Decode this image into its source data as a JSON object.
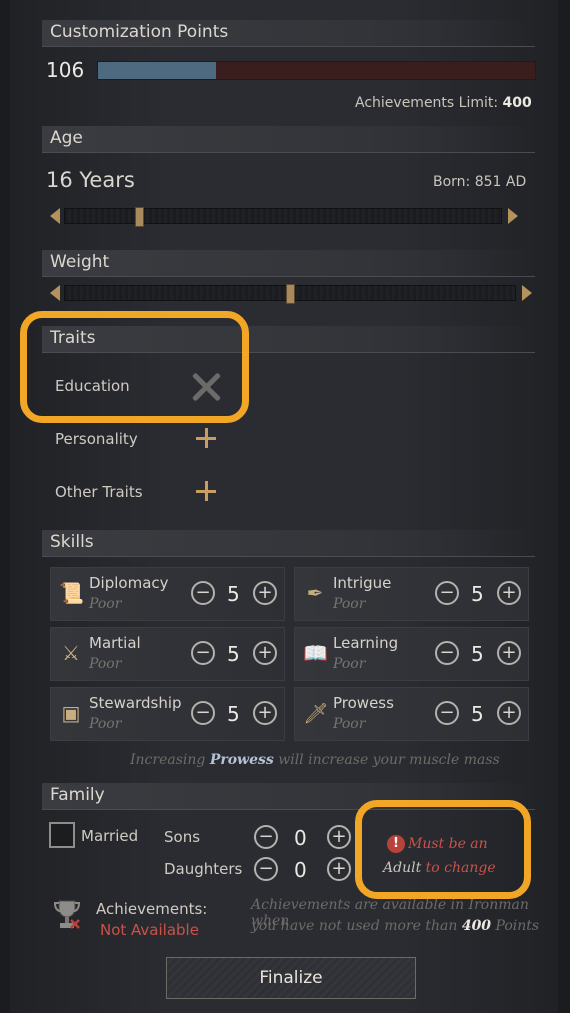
{
  "customization": {
    "header": "Customization Points",
    "points": "106",
    "progress_fraction": 0.27,
    "limit_label": "Achievements Limit:",
    "limit_value": "400"
  },
  "age": {
    "header": "Age",
    "value": "16 Years",
    "born": "Born: 851 AD",
    "slider_fraction": 0.17
  },
  "weight": {
    "header": "Weight",
    "slider_fraction": 0.5
  },
  "traits": {
    "header": "Traits",
    "items": [
      {
        "label": "Education",
        "action": "remove"
      },
      {
        "label": "Personality",
        "action": "add"
      },
      {
        "label": "Other Traits",
        "action": "add"
      }
    ]
  },
  "skills": {
    "header": "Skills",
    "items": [
      {
        "name": "Diplomacy",
        "level": "Poor",
        "value": "5",
        "icon": "scroll-icon"
      },
      {
        "name": "Intrigue",
        "level": "Poor",
        "value": "5",
        "icon": "quill-icon"
      },
      {
        "name": "Martial",
        "level": "Poor",
        "value": "5",
        "icon": "crossed-swords-icon"
      },
      {
        "name": "Learning",
        "level": "Poor",
        "value": "5",
        "icon": "book-icon"
      },
      {
        "name": "Stewardship",
        "level": "Poor",
        "value": "5",
        "icon": "chest-icon"
      },
      {
        "name": "Prowess",
        "level": "Poor",
        "value": "5",
        "icon": "dagger-icon"
      }
    ],
    "note_prefix": "Increasing ",
    "note_highlight": "Prowess",
    "note_suffix": " will increase your muscle mass"
  },
  "family": {
    "header": "Family",
    "married_label": "Married",
    "sons_label": "Sons",
    "sons_value": "0",
    "daughters_label": "Daughters",
    "daughters_value": "0",
    "warning_part1": "Must be an",
    "warning_part2a": "Adult",
    "warning_part2b": " to change"
  },
  "achievements": {
    "label": "Achievements:",
    "status": "Not Available",
    "note_line1": "Achievements are available in Ironman when",
    "note_line2_prefix": "you have not used more than ",
    "note_line2_value": "400",
    "note_line2_suffix": " Points"
  },
  "finalize_label": "Finalize",
  "colors": {
    "highlight": "#f2a626",
    "accent_gold": "#c99c62",
    "warning_red": "#c9524a",
    "progress_blue": "#4d6a80"
  }
}
